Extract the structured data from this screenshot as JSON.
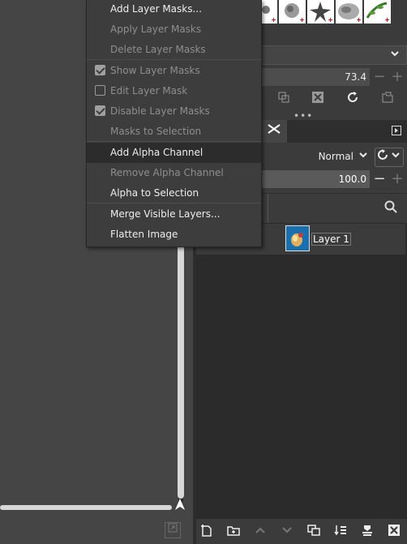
{
  "context_menu": {
    "items": [
      {
        "label": "Add Layer Masks...",
        "enabled": true
      },
      {
        "label": "Apply Layer Masks",
        "enabled": false
      },
      {
        "label": "Delete Layer Masks",
        "enabled": false
      },
      {
        "label": "Show Layer Masks",
        "enabled": false,
        "checkbox": true,
        "checked": true
      },
      {
        "label": "Edit Layer Mask",
        "enabled": false,
        "checkbox": true,
        "checked": false
      },
      {
        "label": "Disable Layer Masks",
        "enabled": false,
        "checkbox": true,
        "checked": true
      },
      {
        "label": "Masks to Selection",
        "enabled": false
      },
      {
        "label": "Add Alpha Channel",
        "enabled": true,
        "highlighted": true
      },
      {
        "label": "Remove Alpha Channel",
        "enabled": false
      },
      {
        "label": "Alpha to Selection",
        "enabled": true
      },
      {
        "label": "Merge Visible Layers...",
        "enabled": true
      },
      {
        "label": "Flatten Image",
        "enabled": true
      }
    ]
  },
  "brush_options": {
    "spacing_value": "73.4"
  },
  "layers_panel": {
    "mode": "Normal",
    "opacity_value": "100.0",
    "layers": [
      {
        "name": "Layer 1"
      }
    ]
  },
  "colors": {
    "menu_bg": "#3d3d3d",
    "highlight_bg": "#2c2c2c",
    "panel_bg": "#3b3b3b",
    "list_bg": "#2b2b2b"
  },
  "icons": {
    "dock_tab": "layers-tab-icon",
    "search": "search-icon",
    "reset": "reset-icon"
  }
}
